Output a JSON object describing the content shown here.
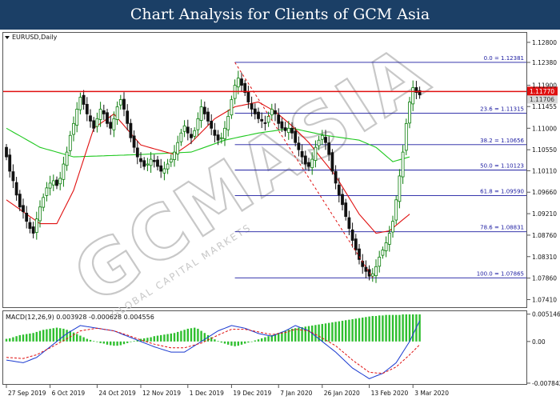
{
  "header": {
    "title": "Chart Analysis for Clients of GCM Asia"
  },
  "watermark": {
    "main": "GCMASIA",
    "sub": "GLOBAL CAPITAL MARKETS",
    "color": "#c8c8c8"
  },
  "chart_data": [
    {
      "type": "candlestick",
      "symbol_label": "EURUSD,Daily",
      "price_axis": {
        "ylim": [
          1.0725,
          1.13
        ],
        "tick_labels": [
          "1.12800",
          "1.12380",
          "1.11900",
          "1.11455",
          "1.11000",
          "1.10550",
          "1.10110",
          "1.09660",
          "1.09210",
          "1.08760",
          "1.08310",
          "1.07860",
          "1.07410"
        ]
      },
      "date_axis": {
        "labels": [
          "27 Sep 2019",
          "6 Oct 2019",
          "24 Oct 2019",
          "12 Nov 2019",
          "1 Dec 2019",
          "19 Dec 2019",
          "7 Jan 2020",
          "26 Jan 2020",
          "13 Feb 2020",
          "3 Mar 2020"
        ],
        "label_bars": [
          0,
          13,
          27,
          40,
          54,
          67,
          81,
          94,
          108,
          121
        ]
      },
      "bar_count": 124,
      "closes": [
        1.104,
        1.101,
        1.099,
        1.096,
        1.0935,
        1.0925,
        1.0905,
        1.089,
        1.088,
        1.091,
        1.0935,
        1.0955,
        1.0975,
        1.0985,
        1.099,
        1.098,
        1.0995,
        1.1025,
        1.105,
        1.1085,
        1.111,
        1.114,
        1.1165,
        1.115,
        1.113,
        1.1115,
        1.11,
        1.112,
        1.114,
        1.113,
        1.111,
        1.11,
        1.112,
        1.1145,
        1.116,
        1.114,
        1.111,
        1.108,
        1.106,
        1.104,
        1.103,
        1.102,
        1.1025,
        1.1035,
        1.103,
        1.102,
        1.101,
        1.1015,
        1.1025,
        1.1035,
        1.105,
        1.107,
        1.109,
        1.1105,
        1.109,
        1.108,
        1.1095,
        1.112,
        1.1145,
        1.113,
        1.1115,
        1.11,
        1.1085,
        1.1075,
        1.108,
        1.11,
        1.1125,
        1.116,
        1.119,
        1.1205,
        1.119,
        1.1175,
        1.1155,
        1.114,
        1.113,
        1.112,
        1.1115,
        1.111,
        1.1125,
        1.114,
        1.113,
        1.111,
        1.11,
        1.1095,
        1.11,
        1.109,
        1.107,
        1.1055,
        1.104,
        1.1025,
        1.102,
        1.1035,
        1.106,
        1.1075,
        1.1085,
        1.107,
        1.1045,
        1.101,
        1.0985,
        1.096,
        1.094,
        1.0915,
        1.089,
        1.0865,
        1.0845,
        1.0825,
        1.081,
        1.08,
        1.079,
        1.0795,
        1.081,
        1.083,
        1.0845,
        1.086,
        1.088,
        1.0905,
        1.095,
        1.1,
        1.105,
        1.111,
        1.1155,
        1.1185,
        1.1175,
        1.117
      ],
      "sma_red_values": [
        1.095,
        1.09,
        1.09,
        1.097,
        1.11,
        1.113,
        1.1065,
        1.1045,
        1.107,
        1.112,
        1.1145,
        1.1155,
        1.1135,
        1.1105,
        1.107,
        1.1,
        1.092,
        1.088,
        1.0885,
        1.092
      ],
      "sma_red_at_bars": [
        0,
        10,
        15,
        20,
        26,
        32,
        40,
        50,
        55,
        62,
        68,
        75,
        80,
        85,
        90,
        98,
        105,
        110,
        114,
        120
      ],
      "sma_green_values": [
        1.11,
        1.106,
        1.104,
        1.1045,
        1.105,
        1.1075,
        1.109,
        1.11,
        1.1085,
        1.1075,
        1.106,
        1.103,
        1.104
      ],
      "sma_green_at_bars": [
        0,
        10,
        20,
        40,
        55,
        65,
        75,
        85,
        95,
        105,
        110,
        115,
        120
      ],
      "horizontal_line": {
        "price": 1.1177,
        "color": "#e01010"
      },
      "current_price_label": "1.11770",
      "previous_price_label": "1.11706",
      "fibonacci": [
        {
          "label": "0.0 = 1.12381",
          "price": 1.12381
        },
        {
          "label": "23.6 = 1.11315",
          "price": 1.11315
        },
        {
          "label": "38.2 = 1.10656",
          "price": 1.10656
        },
        {
          "label": "50.0 = 1.10123",
          "price": 1.10123
        },
        {
          "label": "61.8 = 1.09590",
          "price": 1.0959
        },
        {
          "label": "78.6 = 1.08831",
          "price": 1.08831
        },
        {
          "label": "100.0 = 1.07865",
          "price": 1.07865
        }
      ],
      "fib_start_bar": 68,
      "trend_line": {
        "from_bar": 68,
        "from_price": 1.1238,
        "to_bar": 109,
        "to_price": 1.0787
      },
      "colors": {
        "up": "#0a7d0a",
        "down": "#111111",
        "sma_fast": "#e01010",
        "sma_slow": "#1ec81e",
        "fib": "#1a1aa0"
      }
    },
    {
      "type": "macd",
      "label": "MACD(12,26,9) 0.003928 -0.000628 0.004556",
      "ylim": [
        -0.008,
        0.0057
      ],
      "tick_labels": [
        "0.005146",
        "0.00",
        "-0.007842"
      ],
      "tick_values": [
        0.005146,
        0.0,
        -0.007842
      ],
      "histogram": [
        0.0005,
        0.0006,
        0.0008,
        0.001,
        0.0012,
        0.0013,
        0.0014,
        0.0015,
        0.0016,
        0.0018,
        0.002,
        0.0022,
        0.0023,
        0.0024,
        0.0025,
        0.0026,
        0.0025,
        0.0024,
        0.0022,
        0.002,
        0.0017,
        0.0014,
        0.0011,
        0.0008,
        0.0005,
        0.0003,
        0.0001,
        -0.0001,
        -0.0003,
        -0.0004,
        -0.0006,
        -0.0007,
        -0.0008,
        -0.0008,
        -0.0007,
        -0.0005,
        -0.0003,
        -0.0001,
        0.0001,
        0.0003,
        0.0005,
        0.0006,
        0.0007,
        0.0008,
        0.001,
        0.0011,
        0.0012,
        0.0013,
        0.0014,
        0.0015,
        0.0016,
        0.0018,
        0.002,
        0.0022,
        0.0024,
        0.0025,
        0.0026,
        0.0024,
        0.002,
        0.0016,
        0.0012,
        0.0008,
        0.0004,
        0.0001,
        -0.0002,
        -0.0004,
        -0.0006,
        -0.0008,
        -0.0009,
        -0.0008,
        -0.0006,
        -0.0004,
        -0.0002,
        0.0,
        0.0002,
        0.0004,
        0.0006,
        0.0008,
        0.001,
        0.0012,
        0.0014,
        0.0016,
        0.0018,
        0.002,
        0.0022,
        0.0024,
        0.0025,
        0.0026,
        0.0027,
        0.0028,
        0.0029,
        0.003,
        0.0031,
        0.0032,
        0.0033,
        0.0034,
        0.0035,
        0.0036,
        0.0037,
        0.0038,
        0.0039,
        0.004,
        0.0041,
        0.0042,
        0.0043,
        0.0044,
        0.0045,
        0.0046,
        0.0047,
        0.0048,
        0.0048,
        0.0049,
        0.0049,
        0.005,
        0.005,
        0.005,
        0.005,
        0.005,
        0.0051,
        0.0051,
        0.0051,
        0.0051,
        0.0051,
        0.0051
      ],
      "macd_values": [
        -0.0035,
        -0.004,
        -0.003,
        -0.001,
        0.0015,
        0.003,
        0.0025,
        0.002,
        0.001,
        0.0,
        -0.001,
        -0.002,
        -0.002,
        0.0,
        0.002,
        0.003,
        0.0025,
        0.0015,
        0.001,
        0.002,
        0.003,
        0.002,
        0.0005,
        -0.002,
        -0.005,
        -0.007,
        -0.006,
        -0.004,
        0.0,
        0.0039
      ],
      "macd_at_bars": [
        0,
        5,
        9,
        13,
        18,
        22,
        27,
        32,
        36,
        40,
        44,
        49,
        53,
        58,
        63,
        67,
        71,
        75,
        79,
        83,
        86,
        90,
        93,
        98,
        103,
        108,
        112,
        116,
        120,
        123
      ],
      "signal_values": [
        -0.003,
        -0.0032,
        -0.0025,
        -0.0012,
        0.0005,
        0.002,
        0.0025,
        0.002,
        0.0012,
        0.0003,
        -0.0005,
        -0.0012,
        -0.0012,
        -0.0003,
        0.0012,
        0.0023,
        0.0023,
        0.0018,
        0.0013,
        0.0017,
        0.0023,
        0.002,
        0.001,
        -0.0008,
        -0.0035,
        -0.0058,
        -0.006,
        -0.0048,
        -0.0025,
        -0.0006
      ],
      "colors": {
        "histogram": "#2fbf2f",
        "macd": "#1a3ad0",
        "signal": "#e01010"
      }
    }
  ]
}
